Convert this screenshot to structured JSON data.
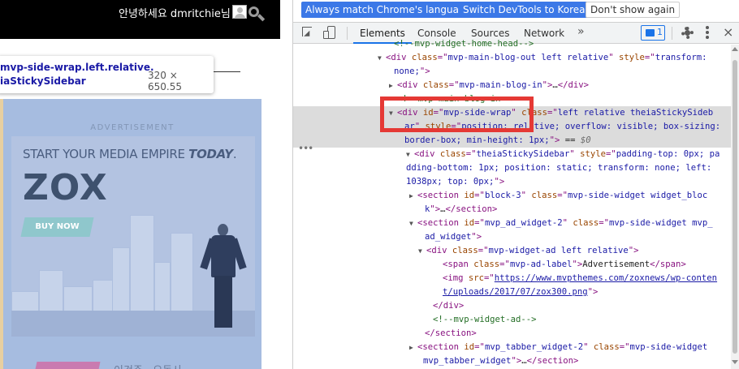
{
  "page": {
    "greeting": "안녕하세요 dmritchie님",
    "tooltip": {
      "selector_line1": "mvp-side-wrap.left.relative.",
      "selector_line2": "iaStickySidebar",
      "size": "320 × 650.55"
    },
    "advertisement_label": "ADVERTISEMENT",
    "ad": {
      "headline_prefix": "START YOUR MEDIA EMPIRE ",
      "headline_emphasis": "TODAY",
      "headline_suffix": ".",
      "logo": "ZOX",
      "buy_button": "BUY NOW"
    },
    "bottom_korean": "이건주 · 오동사"
  },
  "devtools": {
    "infobar": {
      "match_language": "Always match Chrome's language",
      "switch_korean": "Switch DevTools to Korean",
      "dont_show": "Don't show again"
    },
    "tabs": [
      {
        "label": "Elements",
        "active": true
      },
      {
        "label": "Console",
        "active": false
      },
      {
        "label": "Sources",
        "active": false
      },
      {
        "label": "Network",
        "active": false
      }
    ],
    "more_tabs": "»",
    "message_count": "1",
    "close": "×",
    "selection_dots": "•••",
    "rows": [
      {
        "arrow": "",
        "parts": [
          [
            "comment",
            "<!--mvp-widget-home-head-->"
          ]
        ]
      },
      {
        "arrow": "▼",
        "parts": [
          [
            "tag",
            "<div "
          ],
          [
            "attr",
            "class"
          ],
          [
            "tag",
            "=\""
          ],
          [
            "val",
            "mvp-main-blog-out left relative"
          ],
          [
            "tag",
            "\" "
          ],
          [
            "attr",
            "style"
          ],
          [
            "tag",
            "=\""
          ],
          [
            "val",
            "transform:"
          ]
        ]
      },
      {
        "arrow": "",
        "parts": [
          [
            "val",
            "none;"
          ],
          [
            "tag",
            "\">"
          ]
        ]
      },
      {
        "arrow": "▶",
        "parts": [
          [
            "tag",
            "<div "
          ],
          [
            "attr",
            "class"
          ],
          [
            "tag",
            "=\""
          ],
          [
            "val",
            "mvp-main-blog-in"
          ],
          [
            "tag",
            "\">"
          ],
          [
            "text",
            "…"
          ],
          [
            "tag",
            "</div>"
          ]
        ]
      },
      {
        "arrow": "",
        "parts": [
          [
            "comment",
            "<!--mvp-main-blog-in-->"
          ]
        ]
      },
      {
        "arrow": "▼",
        "parts": [
          [
            "tag",
            "<div "
          ],
          [
            "attr",
            "id"
          ],
          [
            "tag",
            "=\""
          ],
          [
            "val",
            "mvp-side-wrap"
          ],
          [
            "tag",
            "\" "
          ],
          [
            "attr",
            "class"
          ],
          [
            "tag",
            "=\""
          ],
          [
            "val",
            "left relative theiaStickySideb"
          ]
        ]
      },
      {
        "arrow": "",
        "parts": [
          [
            "val",
            "ar"
          ],
          [
            "tag",
            "\" "
          ],
          [
            "attr",
            "style"
          ],
          [
            "tag",
            "=\""
          ],
          [
            "val",
            "position: relative; overflow: visible; box-sizing:"
          ]
        ]
      },
      {
        "arrow": "",
        "parts": [
          [
            "val",
            "border-box; min-height: 1px;"
          ],
          [
            "tag",
            "\">"
          ],
          [
            "text",
            " == "
          ],
          [
            "dollar",
            "$0"
          ]
        ]
      },
      {
        "arrow": "▼",
        "parts": [
          [
            "tag",
            "<div "
          ],
          [
            "attr",
            "class"
          ],
          [
            "tag",
            "=\""
          ],
          [
            "val",
            "theiaStickySidebar"
          ],
          [
            "tag",
            "\" "
          ],
          [
            "attr",
            "style"
          ],
          [
            "tag",
            "=\""
          ],
          [
            "val",
            "padding-top: 0px; pa"
          ]
        ]
      },
      {
        "arrow": "",
        "parts": [
          [
            "val",
            "dding-bottom: 1px; position: static; transform: none; left:"
          ]
        ]
      },
      {
        "arrow": "",
        "parts": [
          [
            "val",
            "1038px; top: 0px;"
          ],
          [
            "tag",
            "\">"
          ]
        ]
      },
      {
        "arrow": "▶",
        "parts": [
          [
            "tag",
            "<section "
          ],
          [
            "attr",
            "id"
          ],
          [
            "tag",
            "=\""
          ],
          [
            "val",
            "block-3"
          ],
          [
            "tag",
            "\" "
          ],
          [
            "attr",
            "class"
          ],
          [
            "tag",
            "=\""
          ],
          [
            "val",
            "mvp-side-widget widget_bloc"
          ]
        ]
      },
      {
        "arrow": "",
        "parts": [
          [
            "val",
            "k"
          ],
          [
            "tag",
            "\">"
          ],
          [
            "text",
            "…"
          ],
          [
            "tag",
            "</section>"
          ]
        ]
      },
      {
        "arrow": "▼",
        "parts": [
          [
            "tag",
            "<section "
          ],
          [
            "attr",
            "id"
          ],
          [
            "tag",
            "=\""
          ],
          [
            "val",
            "mvp_ad_widget-2"
          ],
          [
            "tag",
            "\" "
          ],
          [
            "attr",
            "class"
          ],
          [
            "tag",
            "=\""
          ],
          [
            "val",
            "mvp-side-widget mvp_"
          ]
        ]
      },
      {
        "arrow": "",
        "parts": [
          [
            "val",
            "ad_widget"
          ],
          [
            "tag",
            "\">"
          ]
        ]
      },
      {
        "arrow": "▼",
        "parts": [
          [
            "tag",
            "<div "
          ],
          [
            "attr",
            "class"
          ],
          [
            "tag",
            "=\""
          ],
          [
            "val",
            "mvp-widget-ad left relative"
          ],
          [
            "tag",
            "\">"
          ]
        ]
      },
      {
        "arrow": "",
        "parts": [
          [
            "tag",
            "<span "
          ],
          [
            "attr",
            "class"
          ],
          [
            "tag",
            "=\""
          ],
          [
            "val",
            "mvp-ad-label"
          ],
          [
            "tag",
            "\">"
          ],
          [
            "text",
            "Advertisement"
          ],
          [
            "tag",
            "</span>"
          ]
        ]
      },
      {
        "arrow": "",
        "parts": [
          [
            "tag",
            "<img "
          ],
          [
            "attr",
            "src"
          ],
          [
            "tag",
            "=\""
          ],
          [
            "link",
            "https://www.mvpthemes.com/zoxnews/wp-conten"
          ]
        ]
      },
      {
        "arrow": "",
        "parts": [
          [
            "link",
            "t/uploads/2017/07/zox300.png"
          ],
          [
            "tag",
            "\">"
          ]
        ]
      },
      {
        "arrow": "",
        "parts": [
          [
            "tag",
            "</div>"
          ]
        ]
      },
      {
        "arrow": "",
        "parts": [
          [
            "comment",
            "<!--mvp-widget-ad-->"
          ]
        ]
      },
      {
        "arrow": "",
        "parts": [
          [
            "tag",
            "</section>"
          ]
        ]
      },
      {
        "arrow": "▶",
        "parts": [
          [
            "tag",
            "<section "
          ],
          [
            "attr",
            "id"
          ],
          [
            "tag",
            "=\""
          ],
          [
            "val",
            "mvp_tabber_widget-2"
          ],
          [
            "tag",
            "\" "
          ],
          [
            "attr",
            "class"
          ],
          [
            "tag",
            "=\""
          ],
          [
            "val",
            "mvp-side-widget"
          ]
        ]
      },
      {
        "arrow": "",
        "parts": [
          [
            "val",
            "mvp_tabber_widget"
          ],
          [
            "tag",
            "\">"
          ],
          [
            "text",
            "…"
          ],
          [
            "tag",
            "</section>"
          ]
        ]
      }
    ]
  }
}
